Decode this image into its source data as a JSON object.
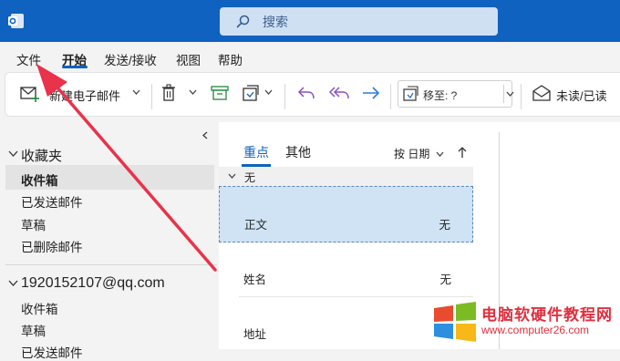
{
  "colors": {
    "accent": "#0f62c0",
    "annotation_arrow": "#e8334a",
    "watermark": "#e0303f"
  },
  "search": {
    "placeholder": "搜索",
    "icon": "search-icon"
  },
  "menu": {
    "items": [
      "文件",
      "开始",
      "发送/接收",
      "视图",
      "帮助"
    ],
    "active": "开始"
  },
  "ribbon": {
    "new_mail": "新建电子邮件",
    "move_to": "移至: ?",
    "unread_read": "未读/已读"
  },
  "sidebar": {
    "favorites_header": "收藏夹",
    "favorites": [
      "收件箱",
      "已发送邮件",
      "草稿",
      "已删除邮件"
    ],
    "selected": "收件箱",
    "account": "1920152107@qq.com",
    "account_folders": [
      "收件箱",
      "草稿",
      "已发送邮件"
    ]
  },
  "message_list": {
    "tabs": [
      "重点",
      "其他"
    ],
    "active_tab": "重点",
    "sort_label": "按 日期",
    "group_label": "无",
    "messages": [
      {
        "from": "正文",
        "subject": "无",
        "selected": true
      },
      {
        "from": "姓名",
        "subject": "无",
        "selected": false
      },
      {
        "from": "地址",
        "subject": "",
        "selected": false
      }
    ]
  },
  "watermark": {
    "title": "电脑软硬件教程网",
    "url": "www.computer26.com"
  }
}
